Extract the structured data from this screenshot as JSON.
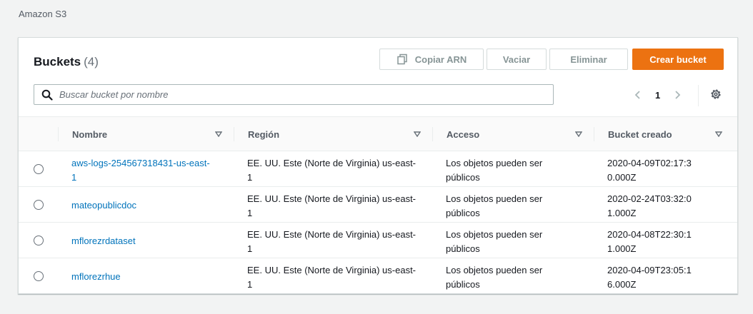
{
  "breadcrumb": "Amazon S3",
  "panel": {
    "title": "Buckets",
    "count": "(4)"
  },
  "toolbar": {
    "copy_arn": "Copiar ARN",
    "empty": "Vaciar",
    "delete": "Eliminar",
    "create": "Crear bucket"
  },
  "search": {
    "placeholder": "Buscar bucket por nombre",
    "value": ""
  },
  "pagination": {
    "current_page": "1"
  },
  "table": {
    "headers": {
      "name": "Nombre",
      "region": "Región",
      "access": "Acceso",
      "created": "Bucket creado"
    },
    "rows": [
      {
        "name": "aws-logs-254567318431-us-east-1",
        "region": "EE. UU. Este (Norte de Virginia) us-east-1",
        "access": "Los objetos pueden ser públicos",
        "created": "2020-04-09T02:17:30.000Z"
      },
      {
        "name": "mateopublicdoc",
        "region": "EE. UU. Este (Norte de Virginia) us-east-1",
        "access": "Los objetos pueden ser públicos",
        "created": "2020-02-24T03:32:01.000Z"
      },
      {
        "name": "mflorezrdataset",
        "region": "EE. UU. Este (Norte de Virginia) us-east-1",
        "access": "Los objetos pueden ser públicos",
        "created": "2020-04-08T22:30:11.000Z"
      },
      {
        "name": "mflorezrhue",
        "region": "EE. UU. Este (Norte de Virginia) us-east-1",
        "access": "Los objetos pueden ser públicos",
        "created": "2020-04-09T23:05:16.000Z"
      }
    ]
  },
  "colors": {
    "primary": "#ec7211",
    "link": "#0073bb",
    "background": "#f2f3f3"
  },
  "icons": {
    "copy": "copy-icon",
    "search": "search-icon",
    "prev": "chevron-left-icon",
    "next": "chevron-right-icon",
    "settings": "gear-icon",
    "sort": "caret-down-icon"
  }
}
